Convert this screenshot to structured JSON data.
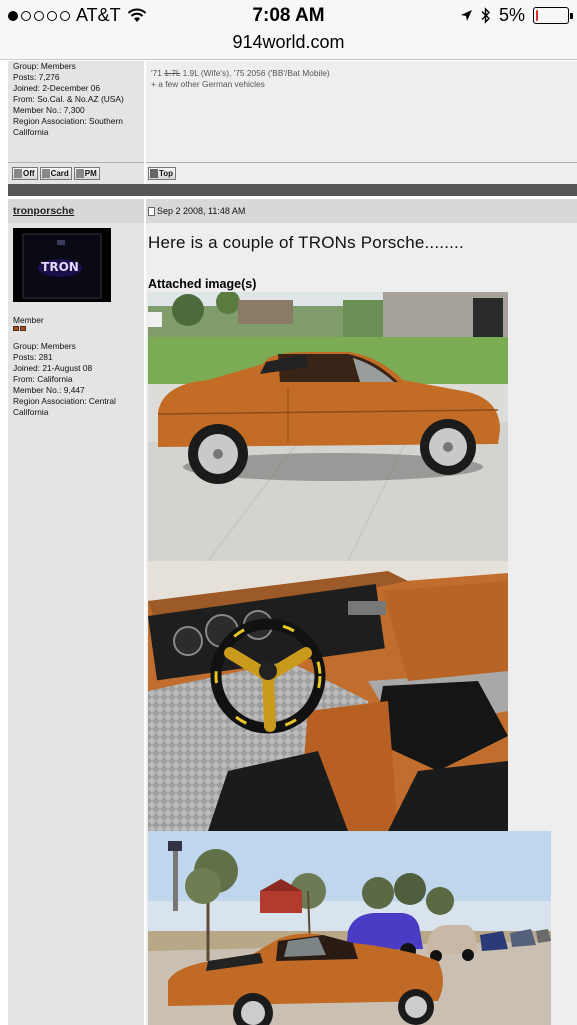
{
  "statusbar": {
    "carrier": "AT&T",
    "time": "7:08 AM",
    "battery_percent": "5%",
    "battery_level": 0.05,
    "signal_bars_filled": 1,
    "signal_bars_total": 5
  },
  "browser": {
    "url": "914world.com"
  },
  "prev_post": {
    "profile": [
      "Group: Members",
      "Posts: 7,276",
      "Joined: 2-December 06",
      "From: So.Cal. & No.AZ (USA)",
      "Member No.: 7,300",
      "Region Association: Southern",
      "California"
    ],
    "signature_line1_prefix": "'71 ",
    "signature_struck": "1.7L",
    "signature_line1_suffix": " 1.9L (Wife's), '75 2056 ('BB'/Bat Mobile)",
    "signature_line2": "+ a few other German vehicles",
    "buttons": {
      "off": "Off",
      "card": "Card",
      "pm": "PM",
      "top": "Top"
    }
  },
  "post": {
    "author": "tronporsche",
    "date": "Sep 2 2008, 11:48 AM",
    "rank": "Member",
    "profile": [
      "Group: Members",
      "Posts: 281",
      "Joined: 21-August 08",
      "From: California",
      "Member No.: 9,447",
      "Region Association: Central",
      "California"
    ],
    "text": "Here is a couple of TRONs Porsche........",
    "attachments_heading": "Attached image(s)",
    "avatar_logo": "TRON"
  },
  "colors": {
    "car_orange": "#c9732c",
    "divider": "#555555",
    "battery_low": "#e0302b"
  }
}
